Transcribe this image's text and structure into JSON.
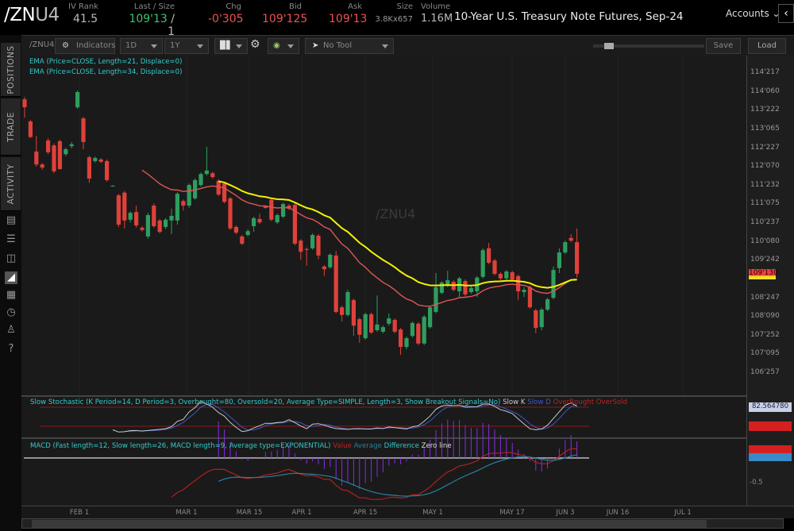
{
  "header": {
    "symbol_main": "/ZN",
    "symbol_suffix": "U4",
    "iv_rank": {
      "label": "IV Rank",
      "value": "41.5"
    },
    "last_size": {
      "label": "Last / Size",
      "value": "109'13",
      "size": " / 1"
    },
    "chg": {
      "label": "Chg",
      "value": "-0'305"
    },
    "bid": {
      "label": "Bid",
      "value": "109'125"
    },
    "ask": {
      "label": "Ask",
      "value": "109'13"
    },
    "size": {
      "label": "Size",
      "value": "3.8Kx657"
    },
    "volume": {
      "label": "Volume",
      "value": "1.16M"
    },
    "description": "10-Year U.S. Treasury Note Futures, Sep-24",
    "accounts": "Accounts"
  },
  "sidebar": {
    "tabs": [
      "POSITIONS",
      "TRADE",
      "ACTIVITY"
    ],
    "icons": [
      "news-icon",
      "list-icon",
      "tv-icon",
      "chart-icon",
      "grid-icon",
      "clock-icon",
      "people-icon",
      "help-icon"
    ]
  },
  "toolbar": {
    "symbol": "/ZNU4",
    "indicators": "Indicators",
    "aggregation": "1D",
    "period": "1Y",
    "tool": "No Tool",
    "save": "Save",
    "load": "Load"
  },
  "chart": {
    "watermark": "/ZNU4",
    "studies": [
      "EMA (Price=CLOSE, Length=21, Displace=0)",
      "EMA (Price=CLOSE, Length=34, Displace=0)"
    ],
    "price_labels": [
      "114'217",
      "114'060",
      "113'222",
      "113'065",
      "112'227",
      "112'070",
      "111'232",
      "111'075",
      "110'237",
      "110'080",
      "109'242",
      "108'247",
      "108'090",
      "107'252",
      "107'095",
      "106'257"
    ],
    "last_price_marker": "109'130",
    "colors": {
      "up": "#2e9e5e",
      "down": "#e0413a",
      "ema21": "#e05555",
      "ema34": "#f2f200",
      "background": "#1a1a1a"
    }
  },
  "stochastic": {
    "title": "Slow Stochastic (K Period=14, D Period=3, Overbought=80, Oversold=20, Average Type=SIMPLE, Length=3, Show Breakout Signals=No)",
    "legend": [
      "Slow K",
      "Slow D",
      "OverBought",
      "OverSold"
    ],
    "slow_k_readout": "82.564780",
    "overbought": 80,
    "oversold": 20
  },
  "macd": {
    "title": "MACD (Fast length=12, Slow length=26, MACD length=9, Average type=EXPONENTIAL)",
    "legend": [
      "Value",
      "Average",
      "Difference",
      "Zero line"
    ],
    "axis_label": "-0.5"
  },
  "dates": [
    "FEB 1",
    "MAR 1",
    "MAR 15",
    "APR 1",
    "APR 15",
    "MAY 1",
    "MAY 17",
    "JUN 3",
    "JUN 16",
    "JUL 1"
  ],
  "chart_data": {
    "type": "candlestick",
    "fields": [
      "open",
      "high",
      "low",
      "close"
    ],
    "ohlc": [
      [
        113.99,
        114.05,
        113.51,
        113.78
      ],
      [
        113.41,
        113.45,
        112.97,
        113.0
      ],
      [
        112.62,
        113.03,
        112.22,
        112.28
      ],
      [
        112.28,
        112.32,
        112.14,
        112.2
      ],
      [
        112.91,
        112.97,
        112.55,
        112.6
      ],
      [
        112.78,
        112.83,
        112.05,
        112.1
      ],
      [
        112.89,
        112.93,
        112.14,
        112.16
      ],
      [
        112.55,
        112.72,
        112.5,
        112.68
      ],
      [
        112.76,
        112.87,
        112.7,
        112.81
      ],
      [
        113.78,
        114.22,
        113.74,
        114.18
      ],
      [
        113.49,
        113.53,
        112.68,
        112.87
      ],
      [
        112.47,
        112.51,
        111.8,
        111.91
      ],
      [
        112.37,
        112.49,
        112.33,
        112.45
      ],
      [
        112.41,
        112.45,
        112.31,
        112.35
      ],
      [
        112.37,
        112.41,
        111.83,
        111.87
      ],
      [
        111.72,
        111.74,
        111.7,
        111.72
      ],
      [
        111.47,
        111.51,
        110.64,
        110.7
      ],
      [
        111.54,
        111.58,
        110.6,
        110.81
      ],
      [
        110.83,
        111.05,
        110.76,
        111.01
      ],
      [
        111.03,
        111.2,
        110.62,
        110.68
      ],
      [
        110.62,
        110.66,
        110.52,
        110.56
      ],
      [
        110.39,
        111.01,
        110.33,
        110.95
      ],
      [
        111.2,
        111.26,
        110.62,
        110.66
      ],
      [
        110.81,
        110.85,
        110.47,
        110.51
      ],
      [
        110.64,
        110.87,
        110.58,
        110.83
      ],
      [
        110.81,
        111.12,
        110.45,
        110.93
      ],
      [
        110.81,
        111.55,
        110.7,
        111.51
      ],
      [
        111.32,
        111.36,
        111.07,
        111.2
      ],
      [
        111.2,
        111.78,
        111.14,
        111.74
      ],
      [
        111.39,
        111.91,
        111.35,
        111.87
      ],
      [
        111.74,
        112.07,
        111.7,
        112.03
      ],
      [
        112.03,
        112.74,
        111.99,
        112.12
      ],
      [
        112.05,
        112.09,
        111.91,
        111.95
      ],
      [
        111.85,
        111.89,
        111.45,
        111.49
      ],
      [
        111.78,
        111.82,
        111.26,
        111.3
      ],
      [
        111.39,
        111.43,
        110.56,
        110.6
      ],
      [
        110.64,
        110.68,
        110.45,
        110.49
      ],
      [
        110.39,
        110.43,
        110.16,
        110.2
      ],
      [
        110.43,
        110.58,
        110.39,
        110.53
      ],
      [
        110.66,
        110.91,
        110.51,
        110.87
      ],
      [
        110.85,
        110.99,
        110.72,
        110.76
      ],
      [
        111.18,
        111.2,
        111.12,
        111.14
      ],
      [
        111.35,
        111.39,
        110.79,
        110.83
      ],
      [
        110.76,
        110.99,
        110.72,
        110.95
      ],
      [
        110.91,
        111.28,
        110.87,
        111.24
      ],
      [
        111.2,
        111.24,
        111.08,
        111.12
      ],
      [
        111.22,
        111.26,
        110.16,
        110.2
      ],
      [
        110.28,
        110.32,
        109.78,
        109.99
      ],
      [
        110.06,
        110.1,
        109.62,
        110.05
      ],
      [
        110.08,
        110.47,
        110.04,
        110.43
      ],
      [
        110.41,
        110.45,
        109.8,
        109.89
      ],
      [
        109.6,
        109.64,
        109.35,
        109.53
      ],
      [
        109.58,
        109.95,
        109.54,
        109.91
      ],
      [
        109.89,
        110.01,
        108.37,
        108.41
      ],
      [
        108.53,
        108.57,
        108.16,
        108.33
      ],
      [
        108.33,
        108.99,
        108.29,
        108.93
      ],
      [
        108.72,
        108.76,
        107.78,
        108.05
      ],
      [
        108.22,
        108.26,
        107.6,
        107.81
      ],
      [
        107.72,
        108.39,
        107.68,
        108.35
      ],
      [
        108.35,
        108.39,
        107.83,
        107.87
      ],
      [
        107.93,
        108.84,
        107.89,
        108.08
      ],
      [
        107.89,
        108.05,
        107.85,
        108.01
      ],
      [
        108.1,
        108.37,
        108.05,
        108.24
      ],
      [
        108.2,
        108.24,
        107.85,
        107.89
      ],
      [
        107.95,
        107.99,
        107.28,
        107.49
      ],
      [
        107.49,
        107.76,
        107.43,
        107.72
      ],
      [
        107.78,
        108.16,
        107.74,
        108.12
      ],
      [
        108.1,
        108.14,
        107.54,
        107.58
      ],
      [
        107.58,
        108.33,
        107.54,
        108.28
      ],
      [
        108.01,
        108.57,
        107.97,
        108.53
      ],
      [
        108.41,
        109.43,
        108.37,
        109.06
      ],
      [
        108.91,
        109.22,
        108.87,
        109.18
      ],
      [
        109.1,
        109.49,
        109.06,
        109.24
      ],
      [
        109.2,
        109.24,
        108.95,
        108.99
      ],
      [
        108.95,
        109.33,
        108.8,
        109.29
      ],
      [
        109.22,
        109.26,
        108.82,
        108.87
      ],
      [
        108.93,
        109.08,
        108.89,
        109.04
      ],
      [
        108.95,
        109.35,
        108.8,
        109.31
      ],
      [
        109.33,
        110.08,
        109.29,
        110.03
      ],
      [
        110.08,
        110.22,
        109.66,
        109.7
      ],
      [
        109.76,
        109.8,
        109.37,
        109.41
      ],
      [
        109.41,
        109.45,
        109.24,
        109.29
      ],
      [
        109.29,
        109.51,
        109.24,
        109.47
      ],
      [
        109.45,
        109.49,
        109.22,
        109.26
      ],
      [
        109.35,
        109.39,
        108.72,
        108.95
      ],
      [
        108.93,
        109.06,
        108.8,
        108.99
      ],
      [
        109.06,
        109.1,
        108.49,
        108.53
      ],
      [
        108.45,
        108.49,
        107.85,
        107.99
      ],
      [
        108.01,
        108.51,
        107.93,
        108.47
      ],
      [
        108.47,
        108.78,
        108.43,
        108.74
      ],
      [
        108.78,
        109.6,
        108.74,
        109.51
      ],
      [
        109.56,
        110.08,
        109.43,
        109.97
      ],
      [
        109.97,
        110.28,
        109.93,
        110.24
      ],
      [
        110.35,
        110.45,
        110.24,
        110.28
      ],
      [
        110.24,
        110.6,
        109.31,
        109.41
      ]
    ],
    "ema_lengths": [
      21,
      34
    ],
    "x_tick_labels": [
      "FEB 1",
      "MAR 1",
      "MAR 15",
      "APR 1",
      "APR 15",
      "MAY 1",
      "MAY 17",
      "JUN 3",
      "JUN 16",
      "JUL 1"
    ]
  }
}
